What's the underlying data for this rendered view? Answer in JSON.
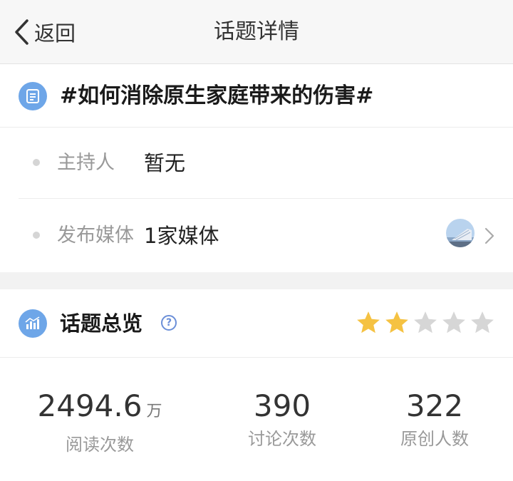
{
  "navbar": {
    "back_label": "返回",
    "title": "话题详情"
  },
  "topic": {
    "title": "#如何消除原生家庭带来的伤害#"
  },
  "host": {
    "label": "主持人",
    "value": "暂无"
  },
  "media": {
    "label": "发布媒体",
    "value": "1家媒体"
  },
  "overview": {
    "title": "话题总览",
    "help_symbol": "?",
    "rating": {
      "filled": 2,
      "total": 5,
      "filled_color": "#f5c242",
      "empty_color": "#d6d6d6"
    },
    "stats": [
      {
        "value": "2494.6",
        "unit": "万",
        "label": "阅读次数"
      },
      {
        "value": "390",
        "unit": "",
        "label": "讨论次数"
      },
      {
        "value": "322",
        "unit": "",
        "label": "原创人数"
      }
    ]
  },
  "colors": {
    "accent_icon": "#6ea6e8",
    "help": "#6b8fd8"
  },
  "icons": [
    "chevron-left-icon",
    "list-icon",
    "chevron-right-icon",
    "bar-chart-icon",
    "help-icon",
    "star-icon"
  ]
}
